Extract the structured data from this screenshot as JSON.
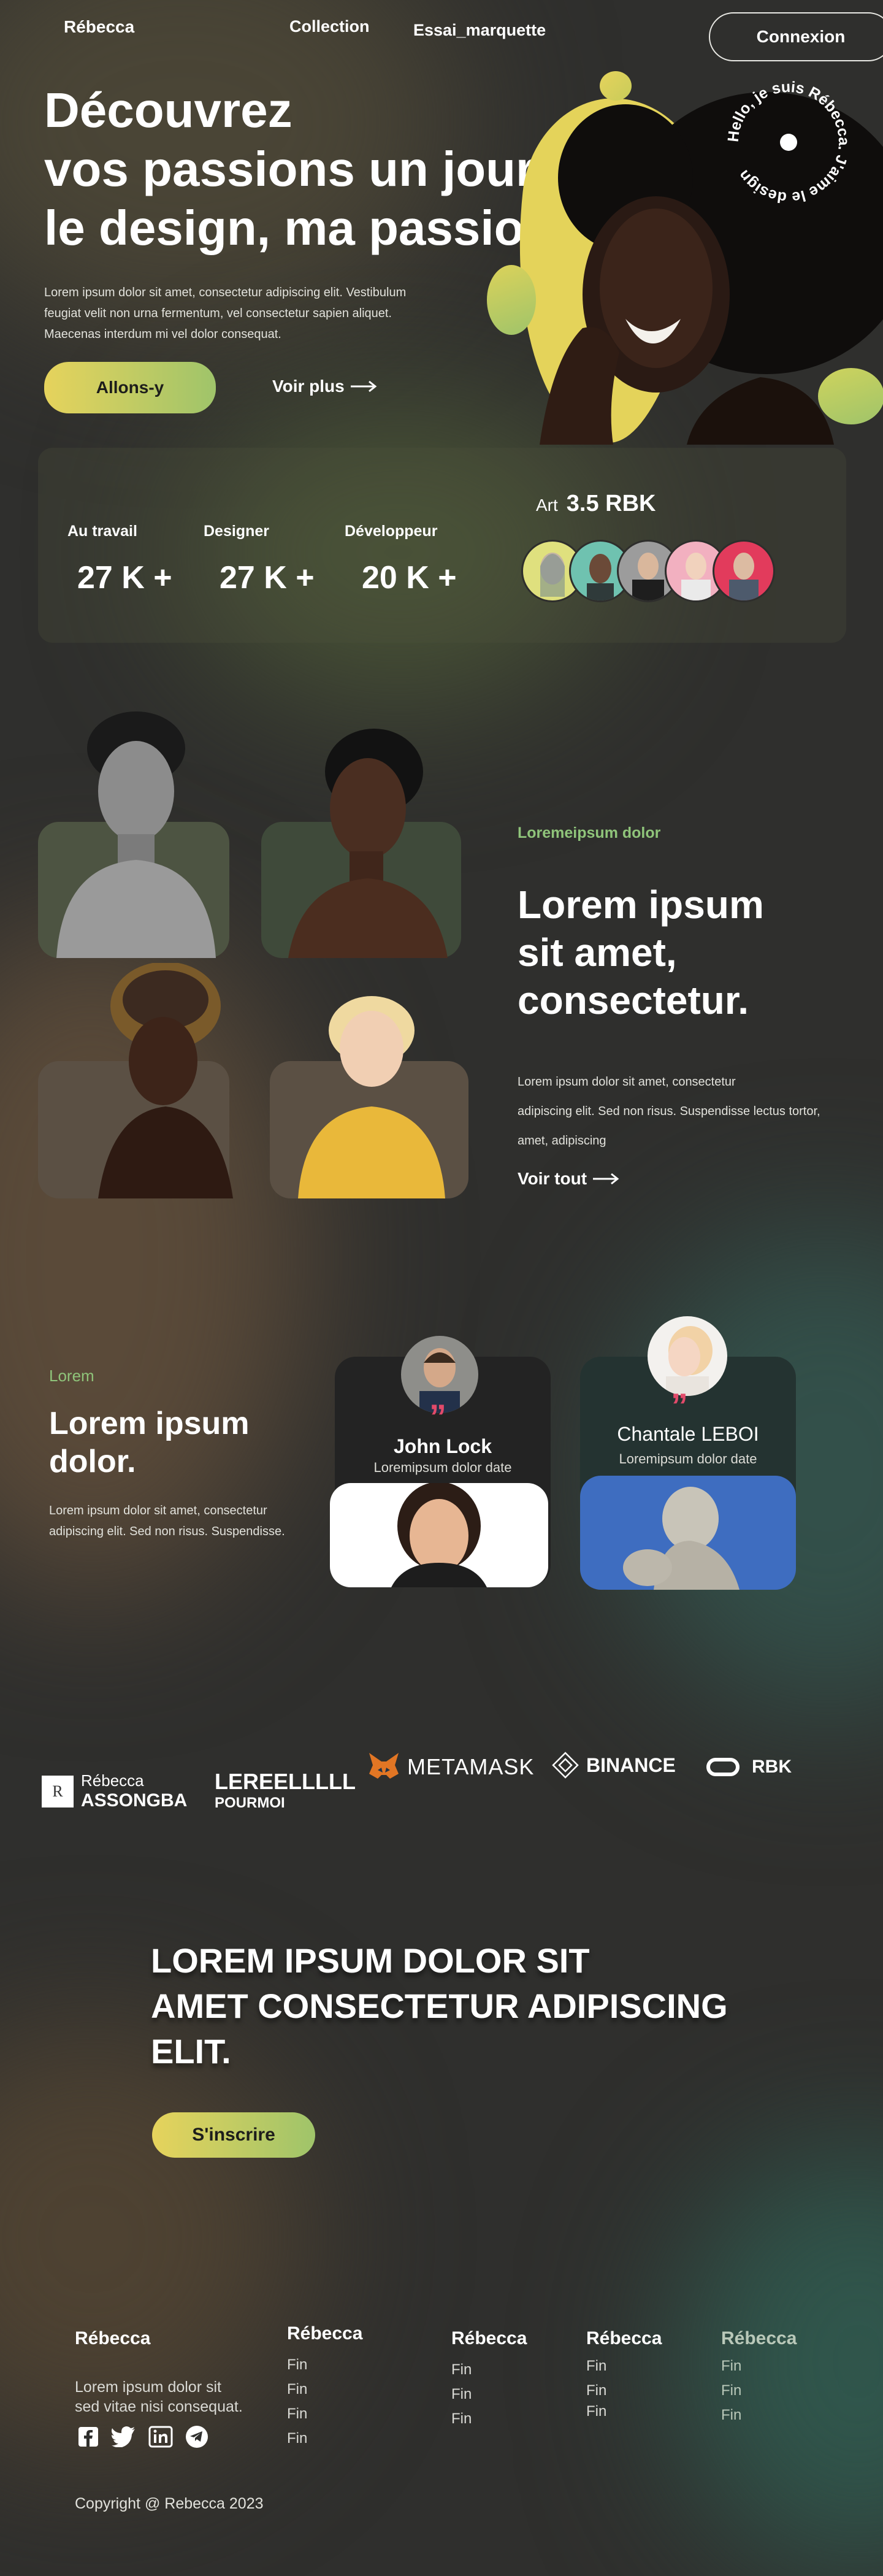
{
  "header": {
    "brand": "Rébecca",
    "nav": [
      "Collection",
      "Essai_marquette"
    ],
    "login": "Connexion"
  },
  "hero": {
    "title_line1": "Découvrez",
    "title_line2": "vos passions un jour,",
    "title_line3": "le design, ma passion.",
    "text_line1": "Lorem ipsum dolor sit amet, consectetur adipiscing elit. Vestibulum",
    "text_line2": "feugiat velit non urna fermentum, vel consectetur sapien aliquet.",
    "text_line3": "Maecenas interdum mi vel dolor consequat.",
    "cta": "Allons-y",
    "more": "Voir plus",
    "badge_text": "Hello, je suis Rébecca. J'aime le design"
  },
  "stats": {
    "items": [
      {
        "label": "Au travail",
        "value": "27 K +"
      },
      {
        "label": "Designer",
        "value": "27 K +"
      },
      {
        "label": "Développeur",
        "value": "20 K +"
      }
    ],
    "art_label": "Art",
    "art_value": "3.5 RBK"
  },
  "gallery": {
    "eyebrow": "Loremeipsum dolor",
    "title_line1": "Lorem ipsum",
    "title_line2": "sit amet,",
    "title_line3": "consectetur.",
    "text_line1": "Lorem ipsum dolor sit amet, consectetur",
    "text_line2": "adipiscing elit. Sed non risus. Suspendisse lectus tortor,",
    "text_line3": "amet, adipiscing",
    "link": "Voir tout"
  },
  "testimonials": {
    "eyebrow": "Lorem",
    "title_line1": "Lorem ipsum",
    "title_line2": "dolor.",
    "text_line1": "Lorem ipsum dolor sit amet, consectetur",
    "text_line2": "adipiscing elit. Sed non risus. Suspendisse.",
    "cards": [
      {
        "name": "John Lock",
        "role": "Loremipsum dolor date"
      },
      {
        "name": "Chantale LEBOI",
        "role": "Loremipsum dolor date"
      }
    ],
    "quote_mark": "”"
  },
  "logos": {
    "assongba_top": "Rébecca",
    "assongba_bottom": "ASSONGBA",
    "assongba_mark": "R",
    "lereel_top": "LEREELLLLL",
    "lereel_bottom": "POURMOI",
    "metamask": "METAMASK",
    "binance": "BINANCE",
    "rbk": "RBK"
  },
  "cta_section": {
    "line1": "LOREM IPSUM DOLOR SIT",
    "line2": "AMET CONSECTETUR ADIPISCING",
    "line3": "ELIT.",
    "button": "S'inscrire"
  },
  "footer": {
    "brand": "Rébecca",
    "text_line1": "Lorem ipsum dolor sit",
    "text_line2": "sed vitae nisi consequat.",
    "columns": [
      {
        "title": "Rébecca",
        "links": [
          "Fin",
          "Fin",
          "Fin",
          "Fin"
        ]
      },
      {
        "title": "Rébecca",
        "links": [
          "Fin",
          "Fin",
          "Fin"
        ]
      },
      {
        "title": "Rébecca",
        "links": [
          "Fin",
          "Fin",
          "Fin"
        ]
      },
      {
        "title": "Rébecca",
        "links": [
          "Fin",
          "Fin",
          "Fin"
        ]
      }
    ],
    "copyright": "Copyright @ Rebecca 2023"
  },
  "colors": {
    "accent_yellow": "#e6d35c",
    "accent_green": "#9fc46a",
    "eyebrow_green": "#8fc47a",
    "quote_red": "#e24a6a",
    "background": "#2f2f2d"
  }
}
